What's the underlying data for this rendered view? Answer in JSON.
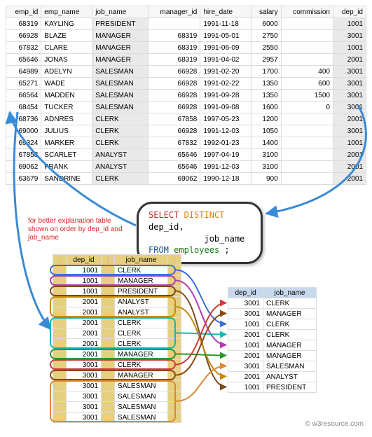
{
  "main_table": {
    "headers": [
      "emp_id",
      "emp_name",
      "job_name",
      "manager_id",
      "hire_date",
      "salary",
      "commission",
      "dep_id"
    ],
    "rows": [
      {
        "emp_id": "68319",
        "emp_name": "KAYLING",
        "job_name": "PRESIDENT",
        "manager_id": "",
        "hire_date": "1991-11-18",
        "salary": "6000",
        "commission": "",
        "dep_id": "1001"
      },
      {
        "emp_id": "66928",
        "emp_name": "BLAZE",
        "job_name": "MANAGER",
        "manager_id": "68319",
        "hire_date": "1991-05-01",
        "salary": "2750",
        "commission": "",
        "dep_id": "3001"
      },
      {
        "emp_id": "67832",
        "emp_name": "CLARE",
        "job_name": "MANAGER",
        "manager_id": "68319",
        "hire_date": "1991-06-09",
        "salary": "2550",
        "commission": "",
        "dep_id": "1001"
      },
      {
        "emp_id": "65646",
        "emp_name": "JONAS",
        "job_name": "MANAGER",
        "manager_id": "68319",
        "hire_date": "1991-04-02",
        "salary": "2957",
        "commission": "",
        "dep_id": "2001"
      },
      {
        "emp_id": "64989",
        "emp_name": "ADELYN",
        "job_name": "SALESMAN",
        "manager_id": "66928",
        "hire_date": "1991-02-20",
        "salary": "1700",
        "commission": "400",
        "dep_id": "3001"
      },
      {
        "emp_id": "65271",
        "emp_name": "WADE",
        "job_name": "SALESMAN",
        "manager_id": "66928",
        "hire_date": "1991-02-22",
        "salary": "1350",
        "commission": "600",
        "dep_id": "3001"
      },
      {
        "emp_id": "66564",
        "emp_name": "MADDEN",
        "job_name": "SALESMAN",
        "manager_id": "66928",
        "hire_date": "1991-09-28",
        "salary": "1350",
        "commission": "1500",
        "dep_id": "3001"
      },
      {
        "emp_id": "68454",
        "emp_name": "TUCKER",
        "job_name": "SALESMAN",
        "manager_id": "66928",
        "hire_date": "1991-09-08",
        "salary": "1600",
        "commission": "0",
        "dep_id": "3001"
      },
      {
        "emp_id": "68736",
        "emp_name": "ADNRES",
        "job_name": "CLERK",
        "manager_id": "67858",
        "hire_date": "1997-05-23",
        "salary": "1200",
        "commission": "",
        "dep_id": "2001"
      },
      {
        "emp_id": "69000",
        "emp_name": "JULIUS",
        "job_name": "CLERK",
        "manager_id": "66928",
        "hire_date": "1991-12-03",
        "salary": "1050",
        "commission": "",
        "dep_id": "3001"
      },
      {
        "emp_id": "69324",
        "emp_name": "MARKER",
        "job_name": "CLERK",
        "manager_id": "67832",
        "hire_date": "1992-01-23",
        "salary": "1400",
        "commission": "",
        "dep_id": "1001"
      },
      {
        "emp_id": "67858",
        "emp_name": "SCARLET",
        "job_name": "ANALYST",
        "manager_id": "65646",
        "hire_date": "1997-04-19",
        "salary": "3100",
        "commission": "",
        "dep_id": "2001"
      },
      {
        "emp_id": "69062",
        "emp_name": "FRANK",
        "job_name": "ANALYST",
        "manager_id": "65646",
        "hire_date": "1991-12-03",
        "salary": "3100",
        "commission": "",
        "dep_id": "2001"
      },
      {
        "emp_id": "63679",
        "emp_name": "SANDRINE",
        "job_name": "CLERK",
        "manager_id": "69062",
        "hire_date": "1990-12-18",
        "salary": "900",
        "commission": "",
        "dep_id": "2001"
      }
    ]
  },
  "sql": {
    "select": "SELECT",
    "distinct": "DISTINCT",
    "cols": "dep_id,",
    "cols2": "job_name",
    "from": "FROM",
    "table": "employees",
    "semi": ";"
  },
  "note_text": "for better explanation table shown on order by dep_id and job_name",
  "ordered": {
    "headers": [
      "dep_id",
      "job_name"
    ],
    "rows": [
      {
        "dep_id": "1001",
        "job_name": "CLERK",
        "color": "#3a6fd8"
      },
      {
        "dep_id": "1001",
        "job_name": "MANAGER",
        "color": "#b43ab4"
      },
      {
        "dep_id": "1001",
        "job_name": "PRESIDENT",
        "color": "#7a4a1a"
      },
      {
        "dep_id": "2001",
        "job_name": "ANALYST",
        "color": "#c58a10"
      },
      {
        "dep_id": "2001",
        "job_name": "ANALYST",
        "color": "#c58a10"
      },
      {
        "dep_id": "2001",
        "job_name": "CLERK",
        "color": "#10b8b0"
      },
      {
        "dep_id": "2001",
        "job_name": "CLERK",
        "color": "#10b8b0"
      },
      {
        "dep_id": "2001",
        "job_name": "CLERK",
        "color": "#10b8b0"
      },
      {
        "dep_id": "2001",
        "job_name": "MANAGER",
        "color": "#2a9a2a"
      },
      {
        "dep_id": "3001",
        "job_name": "CLERK",
        "color": "#d03a3a"
      },
      {
        "dep_id": "3001",
        "job_name": "MANAGER",
        "color": "#8a4a10"
      },
      {
        "dep_id": "3001",
        "job_name": "SALESMAN",
        "color": "#d88a30"
      },
      {
        "dep_id": "3001",
        "job_name": "SALESMAN",
        "color": "#d88a30"
      },
      {
        "dep_id": "3001",
        "job_name": "SALESMAN",
        "color": "#d88a30"
      },
      {
        "dep_id": "3001",
        "job_name": "SALESMAN",
        "color": "#d88a30"
      }
    ]
  },
  "distinct": {
    "headers": [
      "dep_id",
      "job_name"
    ],
    "rows": [
      {
        "dep_id": "3001",
        "job_name": "CLERK"
      },
      {
        "dep_id": "3001",
        "job_name": "MANAGER"
      },
      {
        "dep_id": "1001",
        "job_name": "CLERK"
      },
      {
        "dep_id": "2001",
        "job_name": "CLERK"
      },
      {
        "dep_id": "1001",
        "job_name": "MANAGER"
      },
      {
        "dep_id": "2001",
        "job_name": "MANAGER"
      },
      {
        "dep_id": "3001",
        "job_name": "SALESMAN"
      },
      {
        "dep_id": "2001",
        "job_name": "ANALYST"
      },
      {
        "dep_id": "1001",
        "job_name": "PRESIDENT"
      }
    ]
  },
  "footer_text": "© w3resource.com"
}
